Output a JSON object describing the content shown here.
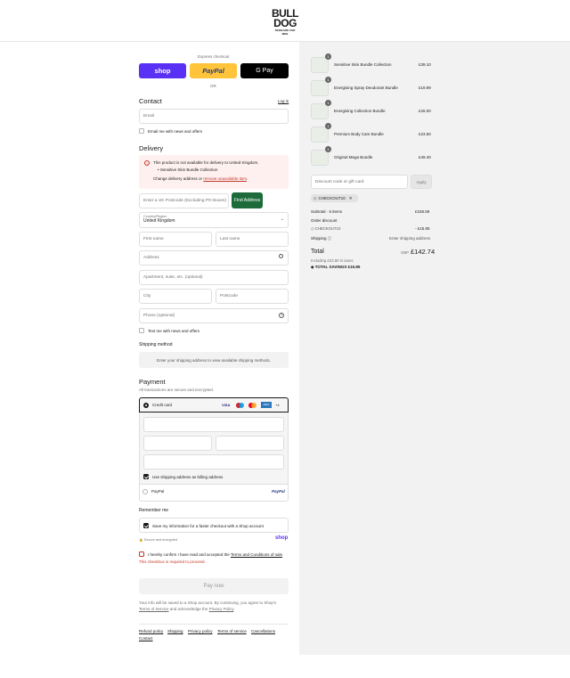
{
  "brand": {
    "line1": "BULL",
    "line2": "DOG",
    "line3": "SKINCARE FOR MEN"
  },
  "express": {
    "label": "Express checkout",
    "shop": "shop",
    "paypal": "PayPal",
    "gpay": "G Pay",
    "or": "OR",
    "shop_color": "#5a31f4",
    "paypal_color": "#ffc439"
  },
  "contact": {
    "title": "Contact",
    "login": "Log in",
    "email_placeholder": "Email",
    "news": "Email me with news and offers"
  },
  "delivery": {
    "title": "Delivery",
    "warning_title": "This product is not available for delivery to United Kingdom.",
    "warning_item": "Sensitive Skin Bundle Collection",
    "warning_change": "Change delivery address or",
    "warning_link": "remove unavailable item",
    "warning_end": ".",
    "postcode_placeholder": "Enter a UK Postcode (Excluding PO Boxes)",
    "find_address": "Find Address",
    "country_label": "Country/Region",
    "country_value": "United Kingdom",
    "first_name": "First name",
    "last_name": "Last name",
    "address": "Address",
    "apartment": "Apartment, suite, etc. (optional)",
    "city": "City",
    "postcode": "Postcode",
    "phone": "Phone (optional)",
    "text_news": "Text me with news and offers"
  },
  "shipping": {
    "title": "Shipping method",
    "note": "Enter your shipping address to view available shipping methods."
  },
  "payment": {
    "title": "Payment",
    "subtitle": "All transactions are secure and encrypted.",
    "credit_card": "Credit card",
    "cards": [
      "VISA",
      "MC",
      "MC",
      "AMEX",
      "+4"
    ],
    "billing": "Use shipping address as billing address",
    "paypal": "PayPal",
    "paypal_logo": "PayPal"
  },
  "remember": {
    "title": "Remember me",
    "save": "Save my information for a faster checkout with a Shop account",
    "secure": "Secure and encrypted",
    "shop": "shop"
  },
  "terms": {
    "prefix": "I hereby confirm I have read and accepted the",
    "link": "Terms and Conditions of sale",
    "suffix": ".",
    "error": "This checkbox is required to proceed."
  },
  "pay": {
    "label": "Pay now"
  },
  "legal": {
    "line1": "Your info will be saved to a Shop account. By continuing, you agree to Shop's",
    "tos": "Terms of Service",
    "and": "and acknowledge the",
    "privacy": "Privacy Policy",
    "end": "."
  },
  "footer": [
    "Refund policy",
    "Shipping",
    "Privacy policy",
    "Terms of service",
    "Cancellations",
    "Contact"
  ],
  "cart": {
    "items": [
      {
        "qty": "1",
        "name": "Sensitive Skin Bundle Collection",
        "price": "£39.10"
      },
      {
        "qty": "1",
        "name": "Energising Spray Deodorant Bundle",
        "price": "£19.99"
      },
      {
        "qty": "1",
        "name": "Energising Collection Bundle",
        "price": "£26.00"
      },
      {
        "qty": "1",
        "name": "Premium Body Care Bundle",
        "price": "£23.50"
      },
      {
        "qty": "1",
        "name": "Original Mega Bundle",
        "price": "£49.40"
      }
    ],
    "discount_placeholder": "Discount code or gift card",
    "apply": "Apply",
    "code_tag": "CHECKOUT10",
    "subtotal_label": "Subtotal · 5 items",
    "subtotal": "£158.59",
    "order_discount": "Order discount",
    "discount_code": "CHECKOUT10",
    "discount_value": "- £15.85",
    "shipping_label": "Shipping",
    "shipping_value": "Enter shipping address",
    "total_label": "Total",
    "currency": "GBP",
    "total": "£142.74",
    "taxes": "Including £23.80 in taxes",
    "savings": "TOTAL SAVINGS  £15.85"
  }
}
